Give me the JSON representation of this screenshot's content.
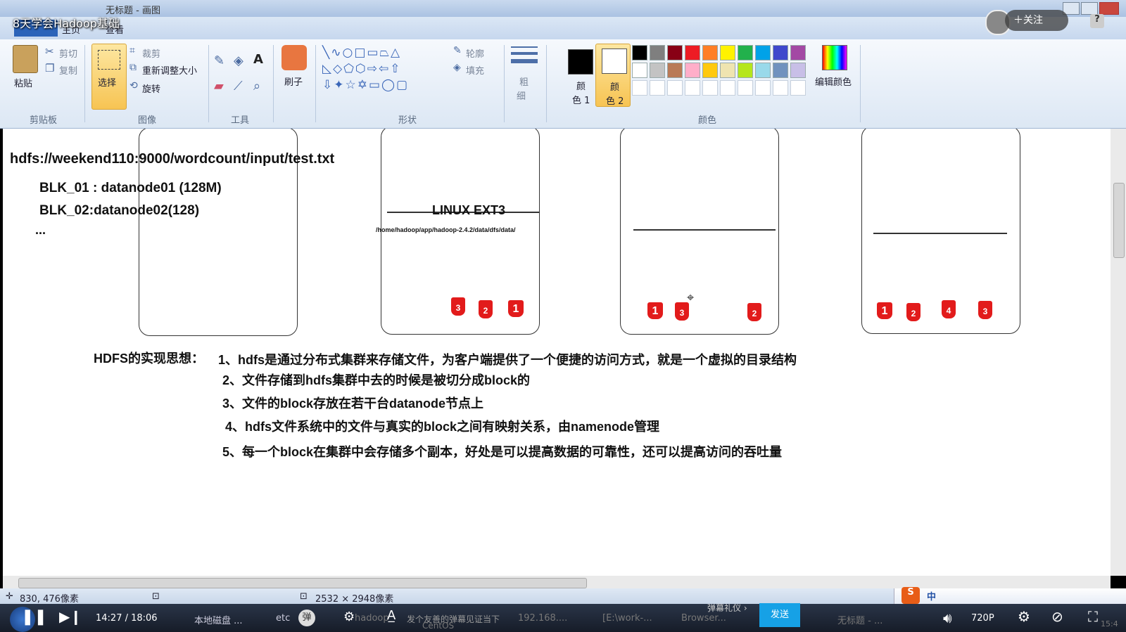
{
  "window": {
    "title": "无标题 - 画图"
  },
  "video": {
    "title": "8天学会Hadoop基础",
    "follow_label": "＋关注",
    "help_label": "?"
  },
  "ribbon_tabs": [
    "主页",
    "查看"
  ],
  "ribbon": {
    "clipboard": {
      "paste": "粘贴",
      "cut": "剪切",
      "copy": "复制",
      "group": "剪贴板"
    },
    "image": {
      "select": "选择",
      "crop": "裁剪",
      "resize": "重新调整大小",
      "rotate": "旋转",
      "group": "图像"
    },
    "tools": {
      "group": "工具",
      "text_icon": "A"
    },
    "brushes": {
      "label": "刷子"
    },
    "shapes": {
      "outline": "轮廓",
      "fill": "填充",
      "group": "形状"
    },
    "size": {
      "label1": "粗",
      "label2": "细"
    },
    "colors": {
      "color1_a": "颜",
      "color1_b": "色 1",
      "color2_a": "颜",
      "color2_b": "色 2",
      "edit": "编辑颜色",
      "group": "颜色",
      "color1": "#000000",
      "color2": "#ffffff",
      "row1": [
        "#000000",
        "#7f7f7f",
        "#880015",
        "#ed1c24",
        "#ff7f27",
        "#fff200",
        "#22b14c",
        "#00a2e8",
        "#3f48cc",
        "#a349a4"
      ],
      "row2": [
        "#ffffff",
        "#c3c3c3",
        "#b97a57",
        "#ffaec9",
        "#ffc90e",
        "#efe4b0",
        "#b5e61d",
        "#99d9ea",
        "#7092be",
        "#c8bfe7"
      ]
    }
  },
  "canvas": {
    "path": "hdfs://weekend110:9000/wordcount/input/test.txt",
    "blk1": "BLK_01 : datanode01 (128M)",
    "blk2": "BLK_02:datanode02(128)",
    "ellipsis": "...",
    "fs_label": "LINUX EXT3",
    "fs_path": "/home/hadoop/app/hadoop-2.4.2/data/dfs/data/",
    "node2_blocks": [
      "3",
      "2",
      "1"
    ],
    "node3_blocks": [
      "1",
      "3",
      "2"
    ],
    "node4_blocks": [
      "1",
      "2",
      "4",
      "3"
    ],
    "idea_title": "HDFS的实现思想：",
    "points": [
      "1、hdfs是通过分布式集群来存储文件，为客户端提供了一个便捷的访问方式，就是一个虚拟的目录结构",
      "2、文件存储到hdfs集群中去的时候是被切分成block的",
      "3、文件的block存放在若干台datanode节点上",
      "4、hdfs文件系统中的文件与真实的block之间有映射关系，由namenode管理",
      "5、每一个block在集群中会存储多个副本，好处是可以提高数据的可靠性，还可以提高访问的吞吐量"
    ]
  },
  "status": {
    "cursor": "830, 476像素",
    "size": "2532 × 2948像素"
  },
  "player": {
    "time": "14:27 / 18:06",
    "danmaku": "弹",
    "danmaku_placeholder": "发个友善的弹幕见证当下",
    "danmaku_gift": "弹幕礼仪 ›",
    "send": "发送",
    "quality": "720P",
    "tasks": [
      "本地磁盘 ...",
      "etc",
      "hadoop",
      "CentOS",
      "192.168....",
      "[E:\\work-...",
      "Browser...",
      "无标题 - ..."
    ],
    "ime": "中",
    "clock": "15:4"
  }
}
